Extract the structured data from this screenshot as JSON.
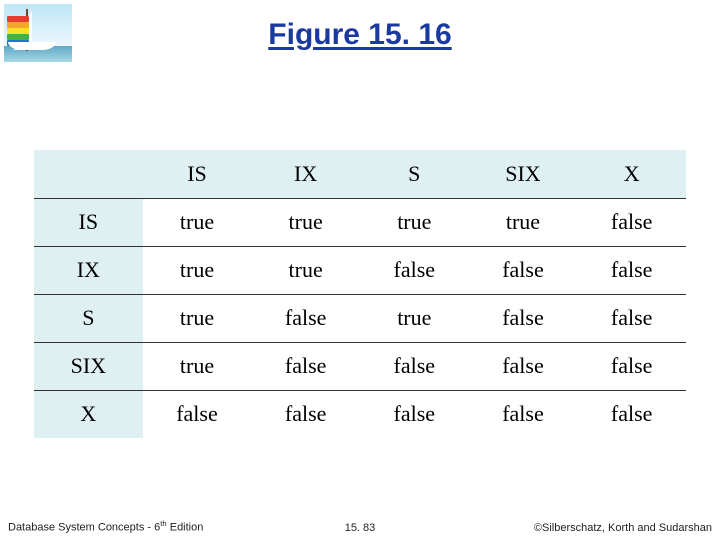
{
  "title": "Figure 15. 16",
  "chart_data": {
    "type": "table",
    "title": "Figure 15.16",
    "columns": [
      "IS",
      "IX",
      "S",
      "SIX",
      "X"
    ],
    "rows": [
      "IS",
      "IX",
      "S",
      "SIX",
      "X"
    ],
    "cells": [
      [
        "true",
        "true",
        "true",
        "true",
        "false"
      ],
      [
        "true",
        "true",
        "false",
        "false",
        "false"
      ],
      [
        "true",
        "false",
        "true",
        "false",
        "false"
      ],
      [
        "true",
        "false",
        "false",
        "false",
        "false"
      ],
      [
        "false",
        "false",
        "false",
        "false",
        "false"
      ]
    ]
  },
  "footer": {
    "left_prefix": "Database System Concepts - 6",
    "left_suffix": " Edition",
    "left_sup": "th",
    "center": "15. 83",
    "right": "©Silberschatz, Korth and Sudarshan"
  }
}
